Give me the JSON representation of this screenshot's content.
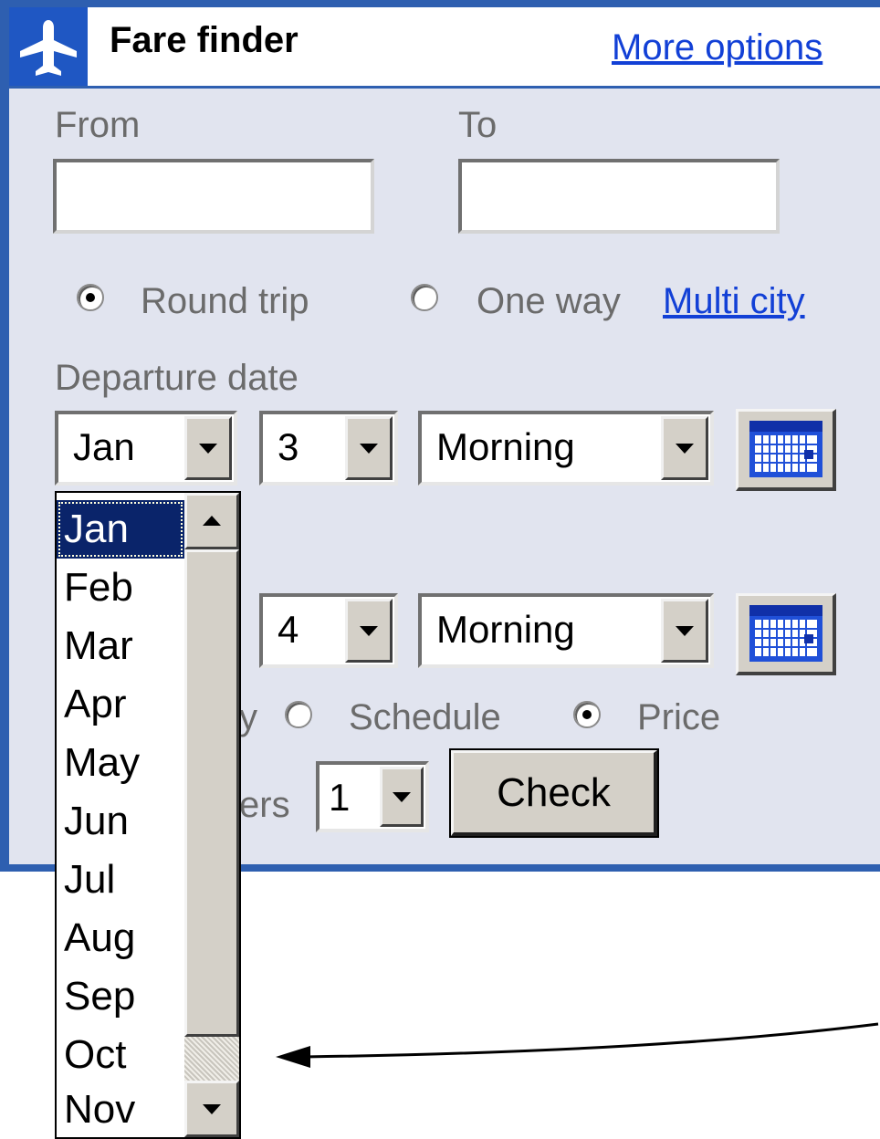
{
  "header": {
    "title": "Fare finder",
    "more_options": "More options"
  },
  "from": {
    "label": "From",
    "value": ""
  },
  "to": {
    "label": "To",
    "value": ""
  },
  "trip_type": {
    "round_trip": "Round trip",
    "one_way": "One way",
    "multi_city": "Multi city",
    "selected": "round_trip"
  },
  "departure": {
    "label": "Departure date",
    "month": "Jan",
    "day": "3",
    "time": "Morning"
  },
  "return": {
    "day": "4",
    "time": "Morning"
  },
  "month_dropdown": {
    "options": [
      "Jan",
      "Feb",
      "Mar",
      "Apr",
      "May",
      "Jun",
      "Jul",
      "Aug",
      "Sep",
      "Oct",
      "Nov"
    ],
    "selected": "Jan"
  },
  "sort": {
    "partial_label": "y",
    "schedule": "Schedule",
    "price": "Price",
    "selected": "price"
  },
  "travelers": {
    "partial_label": "ers",
    "value": "1"
  },
  "check_label": "Check",
  "colors": {
    "panel_bg": "#e1e4ef",
    "border_blue": "#2e5fb0",
    "link_blue": "#1240d6",
    "selected_bg": "#0a246a"
  }
}
